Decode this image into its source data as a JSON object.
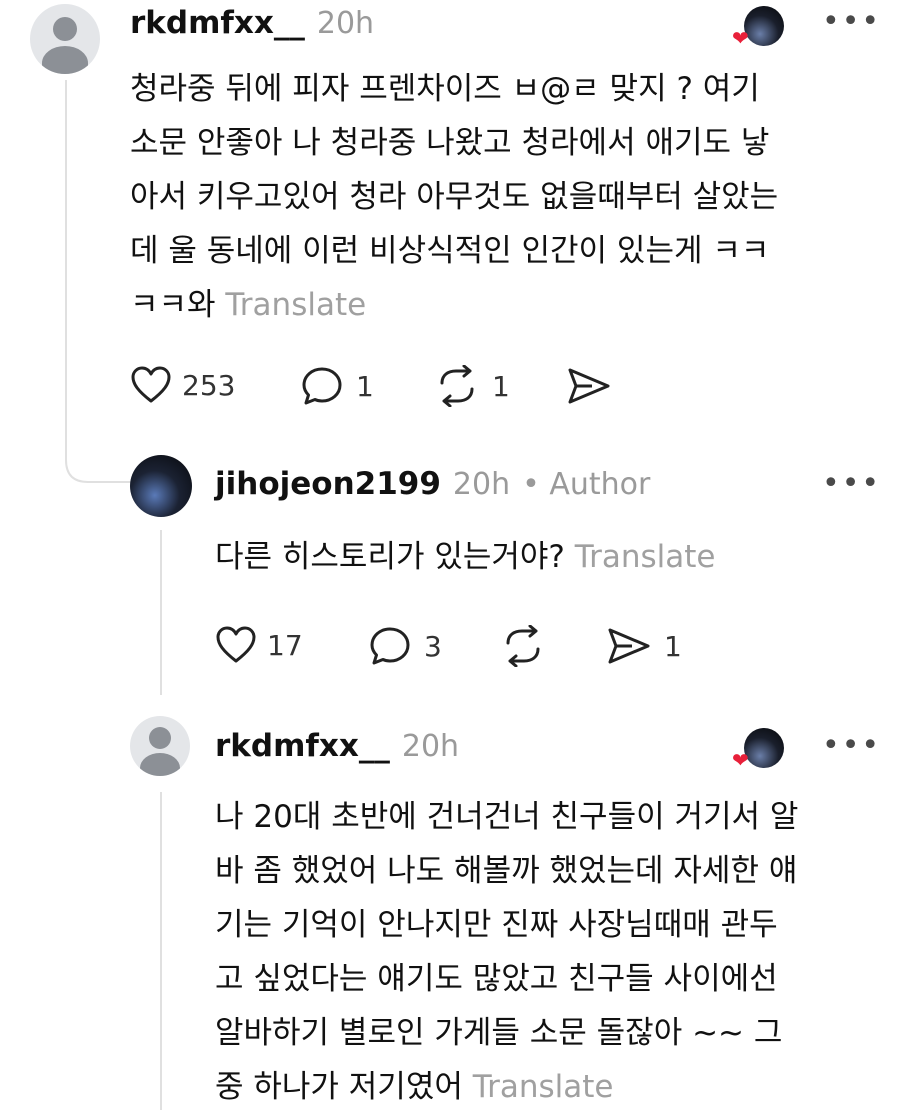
{
  "comments": [
    {
      "username": "rkdmfxx__",
      "time": "20h",
      "text": "청라중 뒤에 피자 프렌차이즈 ㅂ@ㄹ 맞지 ? 여기 소문 안좋아 나 청라중 나왔고 청라에서 애기도 낳아서 키우고있어 청라 아무것도 없을때부터 살았는데 울 동네에 이런 비상식적인 인간이 있는게 ㅋㅋㅋㅋ와",
      "lines": [
        "청라중 뒤에 피자 프렌차이즈 ㅂ@ㄹ 맞지 ? 여기",
        "소문 안좋아 나 청라중 나왔고 청라에서 애기도 낳",
        "아서 키우고있어 청라 아무것도 없을때부터 살았는",
        "데 울 동네에 이런 비상식적인 인간이 있는게 ㅋㅋ",
        "ㅋㅋ와"
      ],
      "translate": "Translate",
      "likes": "253",
      "replies": "1",
      "reposts": "1",
      "shares": ""
    },
    {
      "username": "jihojeon2199",
      "time": "20h",
      "author_badge": "• Author",
      "lines": [
        "다른 히스토리가 있는거야?"
      ],
      "translate": "Translate",
      "likes": "17",
      "replies": "3",
      "reposts": "",
      "shares": "1"
    },
    {
      "username": "rkdmfxx__",
      "time": "20h",
      "lines": [
        "나 20대 초반에 건너건너 친구들이 거기서 알",
        "바 좀 했었어 나도 해볼까 했었는데 자세한 얘",
        "기는 기억이 안나지만 진짜 사장님때매 관두",
        "고 싶었다는 얘기도 많았고 친구들 사이에선",
        "알바하기 별로인 가게들 소문 돌잖아 ~~ 그",
        "중 하나가 저기였어"
      ],
      "translate": "Translate"
    }
  ],
  "icons": {
    "more": "more-horizontal-icon",
    "like": "heart-outline-icon",
    "reply": "speech-bubble-icon",
    "repost": "repost-arrows-icon",
    "share": "send-paper-plane-icon",
    "badge": "heart-badge-icon"
  },
  "colors": {
    "text": "#111111",
    "muted": "#9a9a9a",
    "badge": "#e8203a"
  }
}
